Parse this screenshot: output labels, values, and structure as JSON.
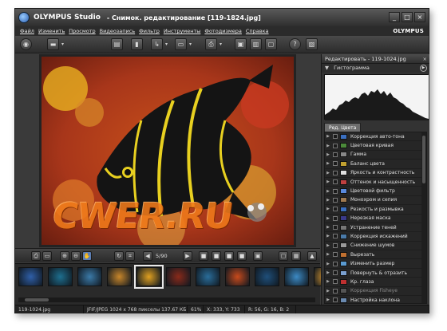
{
  "window": {
    "app_title": "OLYMPUS Studio",
    "doc_title": "- Снимок. редактирование [119-1824.jpg]",
    "brand": "OLYMPUS",
    "buttons": [
      "_",
      "□",
      "×"
    ]
  },
  "menu": [
    "Файл",
    "Изменить",
    "Просмотр",
    "Видеозапись",
    "Фильтр",
    "Инструменты",
    "Фотодизмера",
    "Справка"
  ],
  "image": {
    "watermark": "CWER.RU"
  },
  "navigator": {
    "counter": "5/90"
  },
  "filmstrip": {
    "thumb_colors": [
      "#2f5fa8",
      "#1e6f8f",
      "#3b7aa8",
      "#c8862a",
      "#e0a020",
      "#8a2a1a",
      "#2a6d9a",
      "#c84a1c",
      "#1f4f7a",
      "#3c8ac4",
      "#e8a030"
    ],
    "selected_index": 4
  },
  "status": {
    "file": "119-1024.jpg",
    "info": "JFIF/JPEG 1024 x 768 пикселы 137.67 КБ",
    "zoom": "61%",
    "coords": "X: 333, Y: 733",
    "rgb": "R: 56, G: 16, B: 2"
  },
  "panel": {
    "header": "Редактировать - 119-1024.jpg",
    "histogram_title": "Гистограмма",
    "tab_label": "Ред. Цвета",
    "tools": [
      {
        "label": "Коррекция авто-тона",
        "color": "#3a6fc0",
        "dim": false
      },
      {
        "label": "Цветовая кривая",
        "color": "#4b8a3a",
        "dim": false
      },
      {
        "label": "Гамма",
        "color": "#888888",
        "dim": false
      },
      {
        "label": "Баланс цвета",
        "color": "#c0a030",
        "dim": false
      },
      {
        "label": "Яркость и контрастность",
        "color": "#e0e0e0",
        "dim": false
      },
      {
        "label": "Оттенок и насыщенность",
        "color": "#c04040",
        "dim": false
      },
      {
        "label": "Цветовой фильтр",
        "color": "#5a8adc",
        "dim": false
      },
      {
        "label": "Монохром и сепия",
        "color": "#a07a50",
        "dim": false
      },
      {
        "label": "Резкость и размывка",
        "color": "#3a6fc0",
        "dim": false
      },
      {
        "label": "Нерезкая маска",
        "color": "#3a3a8a",
        "dim": false
      },
      {
        "label": "Устранение теней",
        "color": "#777777",
        "dim": false
      },
      {
        "label": "Коррекция искажений",
        "color": "#4a7aa8",
        "dim": false
      },
      {
        "label": "Снижение шумов",
        "color": "#9a9a9a",
        "dim": false
      },
      {
        "label": "Вырезать",
        "color": "#c07030",
        "dim": false
      },
      {
        "label": "Изменить размер",
        "color": "#5a9ad0",
        "dim": false
      },
      {
        "label": "Повернуть & отразить",
        "color": "#7aa0d0",
        "dim": false
      },
      {
        "label": "Кр. глаза",
        "color": "#c03030",
        "dim": false
      },
      {
        "label": "Коррекция Fisheye",
        "color": "#555555",
        "dim": true
      },
      {
        "label": "Настройка наклона",
        "color": "#6a8ab0",
        "dim": false
      }
    ]
  }
}
